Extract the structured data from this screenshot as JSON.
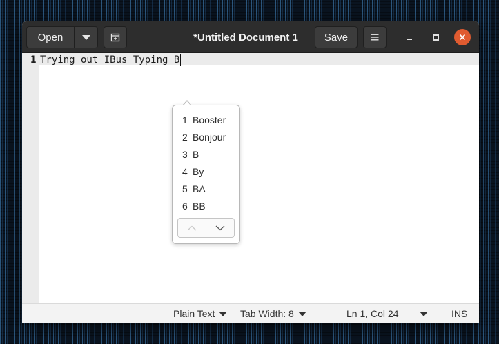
{
  "window": {
    "title": "*Untitled Document 1",
    "open_label": "Open",
    "save_label": "Save"
  },
  "editor": {
    "line_number": "1",
    "text": "Trying out IBus Typing B"
  },
  "candidates": [
    {
      "index": "1",
      "word": "Booster"
    },
    {
      "index": "2",
      "word": "Bonjour"
    },
    {
      "index": "3",
      "word": "B"
    },
    {
      "index": "4",
      "word": "By"
    },
    {
      "index": "5",
      "word": "BA"
    },
    {
      "index": "6",
      "word": "BB"
    }
  ],
  "statusbar": {
    "language": "Plain Text",
    "tab_width": "Tab Width: 8",
    "position": "Ln 1, Col 24",
    "mode": "INS"
  },
  "colors": {
    "headerbar": "#2d2d2d",
    "close_button": "#e05b30",
    "current_line": "#ebebeb"
  },
  "icons": {
    "open_menu": "chevron-down-icon",
    "new_tab": "new-tab-icon",
    "menu": "hamburger-menu-icon",
    "minimize": "minimize-icon",
    "maximize": "maximize-icon",
    "close": "close-icon",
    "page_up": "chevron-up-icon",
    "page_down": "chevron-down-icon"
  }
}
